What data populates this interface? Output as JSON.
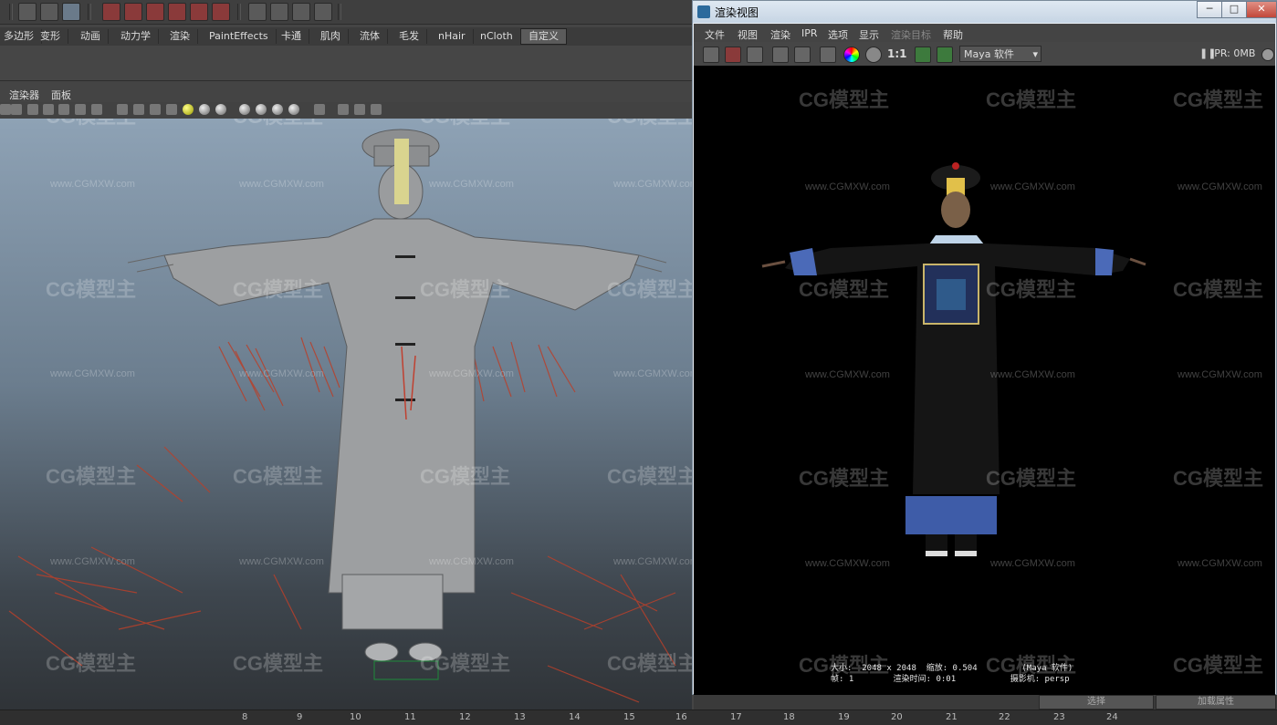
{
  "maya": {
    "shelf_tabs": [
      "多边形",
      "变形",
      "动画",
      "动力学",
      "渲染",
      "PaintEffects",
      "卡通",
      "肌肉",
      "流体",
      "毛发",
      "nHair",
      "nCloth",
      "自定义"
    ],
    "active_shelf_tab": "自定义",
    "panel_menus": [
      "渲染器",
      "面板"
    ]
  },
  "render_view": {
    "title": "渲染视图",
    "menus": [
      "文件",
      "视图",
      "渲染",
      "IPR",
      "选项",
      "显示",
      "渲染目标",
      "帮助"
    ],
    "ratio_label": "1:1",
    "renderer": "Maya 软件",
    "ipr_status": "IPR: 0MB",
    "info_line1": "大小:  2048 x 2048  缩放: 0.504         (Maya 软件)",
    "info_line2": "帧: 1        渲染时间: 0:01           摄影机: persp"
  },
  "watermark": {
    "logo": "CG模型主",
    "url": "www.CGMXW.com"
  },
  "timeline": {
    "ticks": [
      "8",
      "9",
      "10",
      "11",
      "12",
      "13",
      "14",
      "15",
      "16",
      "17",
      "18",
      "19",
      "20",
      "21",
      "22",
      "23",
      "24"
    ]
  },
  "bottom_buttons": [
    "选择",
    "加载属性"
  ],
  "colors": {
    "render_bg": "#000000",
    "viewport_top": "#8ea2b5",
    "title_gradient": "#c6d5e4"
  }
}
